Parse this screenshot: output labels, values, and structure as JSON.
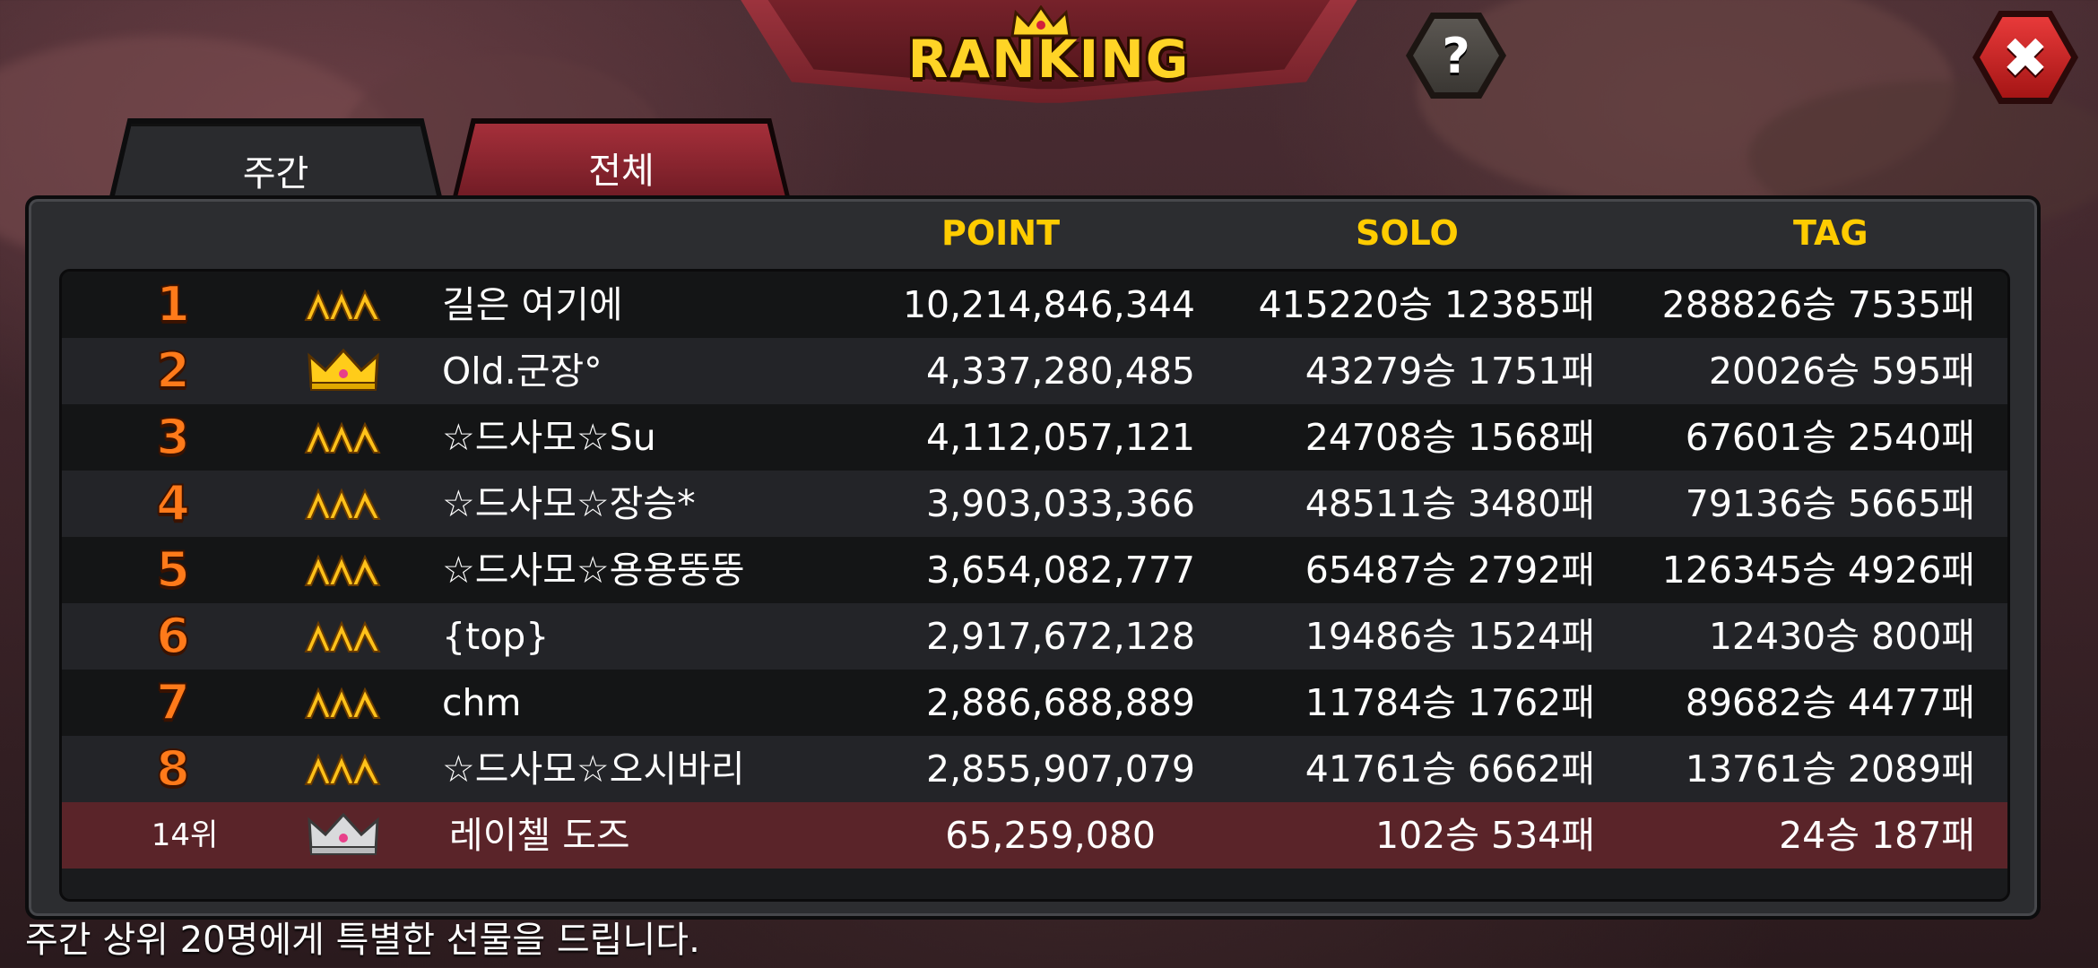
{
  "title": "RANKING",
  "buttons": {
    "help": "?",
    "close": "✖"
  },
  "tabs": [
    {
      "label": "주간",
      "active": true
    },
    {
      "label": "전체",
      "active": false
    }
  ],
  "columns": {
    "point": "POINT",
    "solo": "SOLO",
    "tag": "TAG"
  },
  "rows": [
    {
      "rank": "1",
      "icon": "tier-chevron-icon",
      "name": "길은 여기에",
      "point": "10,214,846,344",
      "solo": "415220승 12385패",
      "tag": "288826승 7535패"
    },
    {
      "rank": "2",
      "icon": "gold-crown-icon",
      "name": "Old.군장°",
      "point": "4,337,280,485",
      "solo": "43279승 1751패",
      "tag": "20026승 595패"
    },
    {
      "rank": "3",
      "icon": "tier-chevron-icon",
      "name": "☆드사모☆Su",
      "point": "4,112,057,121",
      "solo": "24708승 1568패",
      "tag": "67601승 2540패"
    },
    {
      "rank": "4",
      "icon": "tier-chevron-icon",
      "name": "☆드사모☆장승*",
      "point": "3,903,033,366",
      "solo": "48511승 3480패",
      "tag": "79136승 5665패"
    },
    {
      "rank": "5",
      "icon": "tier-chevron-icon",
      "name": "☆드사모☆용용뚱뚱",
      "point": "3,654,082,777",
      "solo": "65487승 2792패",
      "tag": "126345승 4926패"
    },
    {
      "rank": "6",
      "icon": "tier-chevron-icon",
      "name": "{top}",
      "point": "2,917,672,128",
      "solo": "19486승 1524패",
      "tag": "12430승 800패"
    },
    {
      "rank": "7",
      "icon": "tier-chevron-icon",
      "name": "chm",
      "point": "2,886,688,889",
      "solo": "11784승 1762패",
      "tag": "89682승 4477패"
    },
    {
      "rank": "8",
      "icon": "tier-chevron-icon",
      "name": "☆드사모☆오시바리",
      "point": "2,855,907,079",
      "solo": "41761승 6662패",
      "tag": "13761승 2089패"
    }
  ],
  "my_row": {
    "rank": "14위",
    "icon": "silver-crown-icon",
    "name": "레이첼 도즈",
    "point": "65,259,080",
    "solo": "102승 534패",
    "tag": "24승 187패"
  },
  "footer": "주간 상위 20명에게 특별한 선물을 드립니다.",
  "colors": {
    "accent": "#ffcc00",
    "rank": "#ff7a1a",
    "my_row": "#5a2429",
    "tab_active": "#2a2b2e",
    "tab_inactive": "#8e2630"
  }
}
